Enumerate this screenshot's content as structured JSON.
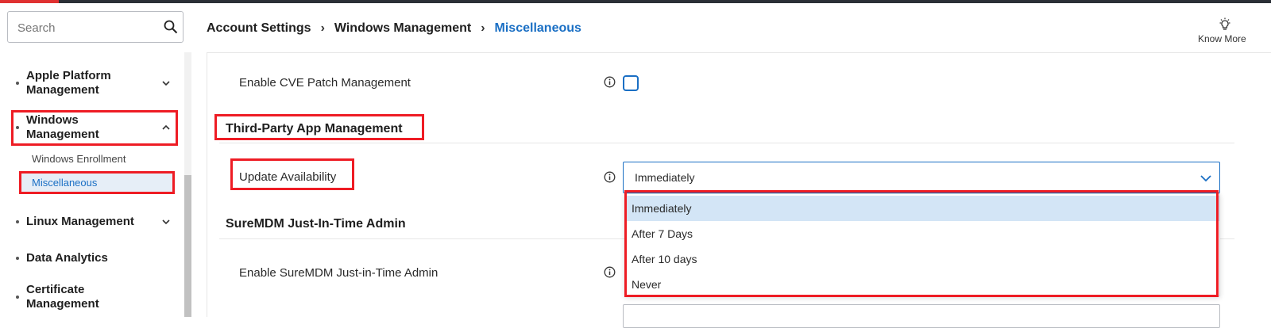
{
  "search": {
    "placeholder": "Search"
  },
  "sidebar": {
    "items": [
      {
        "label": "Apple Platform Management",
        "expanded": false
      },
      {
        "label": "Windows Management",
        "expanded": true,
        "children": [
          {
            "label": "Windows Enrollment",
            "active": false
          },
          {
            "label": "Miscellaneous",
            "active": true
          }
        ]
      },
      {
        "label": "Linux Management",
        "expanded": false
      },
      {
        "label": "Data Analytics"
      },
      {
        "label": "Certificate Management"
      }
    ]
  },
  "breadcrumb": [
    "Account Settings",
    "Windows Management",
    "Miscellaneous"
  ],
  "header": {
    "know_more_label": "Know More"
  },
  "settings": {
    "cve_label": "Enable CVE Patch Management",
    "cve_checked": false,
    "third_party_title": "Third-Party App Management",
    "update_label": "Update Availability",
    "update_value": "Immediately",
    "update_options": [
      "Immediately",
      "After 7 Days",
      "After 10 days",
      "Never"
    ],
    "jit_title": "SureMDM Just-In-Time Admin",
    "jit_label": "Enable SureMDM Just-in-Time Admin"
  },
  "colors": {
    "accent": "#1a6fc4",
    "highlight": "#ee1c24",
    "selected_option": "#d3e5f6"
  }
}
